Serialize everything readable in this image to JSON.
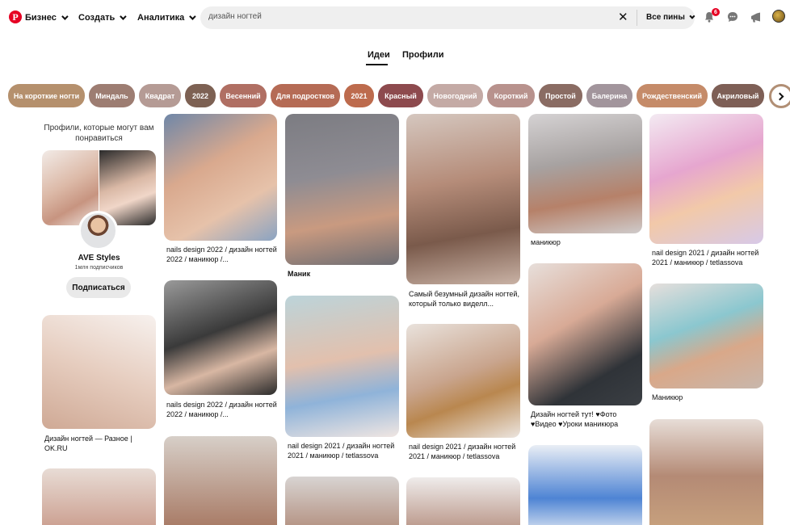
{
  "header": {
    "logo_letter": "P",
    "business_label": "Бизнес",
    "create_label": "Создать",
    "analytics_label": "Аналитика",
    "search_value": "дизайн ногтей",
    "clear_glyph": "✕",
    "filter_label": "Все пины",
    "notification_count": "6"
  },
  "tabs": {
    "ideas": "Идеи",
    "profiles": "Профили"
  },
  "chips": [
    {
      "label": "На короткие ногти",
      "color": "#b5906d"
    },
    {
      "label": "Миндаль",
      "color": "#9d7d72"
    },
    {
      "label": "Квадрат",
      "color": "#b59b95"
    },
    {
      "label": "2022",
      "color": "#7d6153"
    },
    {
      "label": "Весенний",
      "color": "#b06f63"
    },
    {
      "label": "Для подростков",
      "color": "#b56b55"
    },
    {
      "label": "2021",
      "color": "#bd6b4d"
    },
    {
      "label": "Красный",
      "color": "#8d4a4e"
    },
    {
      "label": "Новогодний",
      "color": "#c4aaa5"
    },
    {
      "label": "Короткий",
      "color": "#b8928d"
    },
    {
      "label": "Простой",
      "color": "#8a6c63"
    },
    {
      "label": "Балерина",
      "color": "#a2959c"
    },
    {
      "label": "Рождественский",
      "color": "#c58b69"
    },
    {
      "label": "Акриловый",
      "color": "#7e5f56"
    }
  ],
  "profile_card": {
    "heading": "Профили, которые могут вам понравиться",
    "name": "AVE Styles",
    "subscribers": "1млн подписчиков",
    "subscribe_label": "Подписаться"
  },
  "pins": [
    {
      "title": "",
      "bg": "linear-gradient(160deg,#f3ece8,#d9b8aa 45%,#c99d8e)"
    },
    {
      "title": "Дизайн ногтей — Разное | OK.RU",
      "bg": "linear-gradient(200deg,#f7f1ee,#e6cdbf 50%,#cfa995)"
    },
    {
      "title": "",
      "bg": "linear-gradient(180deg,#e8dcd5,#c99a8a)"
    },
    {
      "title": "nails design 2022 / дизайн ногтей 2022 / маникюр /...",
      "bg": "linear-gradient(150deg,#6f87a8,#d9a98e 40%,#e6c2aa 70%,#8aa3c2)"
    },
    {
      "title": "nails design 2022 / дизайн ногтей 2022 / маникюр /...",
      "bg": "linear-gradient(160deg,#9a9a9a,#3a3a3a 45%,#d8b7a3 70%,#2b2b2b)"
    },
    {
      "title": "",
      "bg": "linear-gradient(180deg,#d7cfc8,#a5755f)"
    },
    {
      "title": "Маник",
      "bg": "linear-gradient(170deg,#7c7c82,#8e8c93 40%,#c99a80 70%,#6d6d73)"
    },
    {
      "title": "nail design 2021 / дизайн ногтей 2021 / маникюр / tetlassova",
      "bg": "linear-gradient(170deg,#bcd4da,#e2c0ad 45%,#8fb3d9 70%,#f0e6e2)"
    },
    {
      "title": "",
      "bg": "linear-gradient(180deg,#d8d4d2,#b18c7b)"
    },
    {
      "title": "Самый безумный дизайн ногтей, который только виделл...",
      "bg": "linear-gradient(170deg,#d5c7bf,#b58c79 40%,#7a5a4b 70%,#c9b2a5)"
    },
    {
      "title": "nail design 2021 / дизайн ногтей 2021 / маникюр / tetlassova",
      "bg": "linear-gradient(160deg,#e9e2dc,#c9a58e 45%,#b9874f 65%,#ece5df)"
    },
    {
      "title": "",
      "bg": "linear-gradient(180deg,#efeceb,#b58f80)"
    },
    {
      "title": "маникюр",
      "bg": "linear-gradient(170deg,#d5d2d3,#a7a2a1 40%,#b68169 70%,#cfcbcb)"
    },
    {
      "title": "Дизайн ногтей тут! ♥Фото ♥Видео ♥Уроки маникюра",
      "bg": "linear-gradient(150deg,#e7dfdb,#d8aa96 40%,#2f3338 75%,#3b3f44)"
    },
    {
      "title": "",
      "bg": "linear-gradient(180deg,#e9eef5,#4e84d4 60%,#dfe7f2)"
    },
    {
      "title": "nail design 2021 / дизайн ногтей 2021 / маникюр / tetlassova",
      "bg": "linear-gradient(160deg,#f3eaf2,#e6a6cf 40%,#f2c9a9 65%,#d7c9e8)"
    },
    {
      "title": "Маникюр",
      "bg": "linear-gradient(160deg,#e6dfdc,#8bc7cf 40%,#d9a889 65%,#c8b7ac)"
    },
    {
      "title": "",
      "bg": "linear-gradient(180deg,#e7ddd7,#b48a75 50%,#c9a37e)"
    }
  ]
}
